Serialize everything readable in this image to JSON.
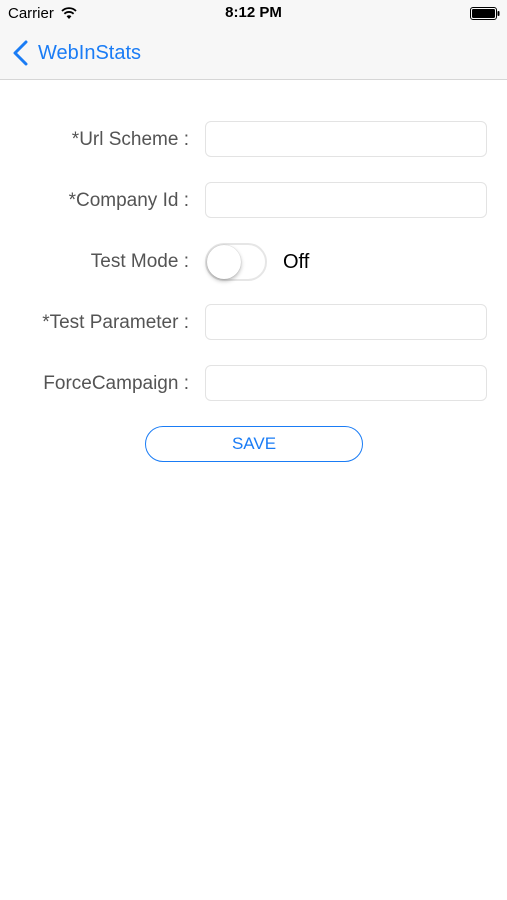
{
  "status_bar": {
    "carrier": "Carrier",
    "time": "8:12 PM",
    "icons": [
      "wifi-icon",
      "battery-icon"
    ]
  },
  "nav_bar": {
    "back_label": "WebInStats",
    "back_icon": "chevron-left-icon",
    "accent_color": "#1a7cf5"
  },
  "form": {
    "url_scheme": {
      "label": "*Url Scheme :",
      "value": "",
      "placeholder": ""
    },
    "company_id": {
      "label": "*Company Id :",
      "value": "",
      "placeholder": ""
    },
    "test_mode": {
      "label": "Test Mode :",
      "state": "Off",
      "on": false
    },
    "test_parameter": {
      "label": "*Test Parameter :",
      "value": "",
      "placeholder": ""
    },
    "force_campaign": {
      "label": "ForceCampaign :",
      "value": "",
      "placeholder": ""
    },
    "save_label": "SAVE"
  }
}
